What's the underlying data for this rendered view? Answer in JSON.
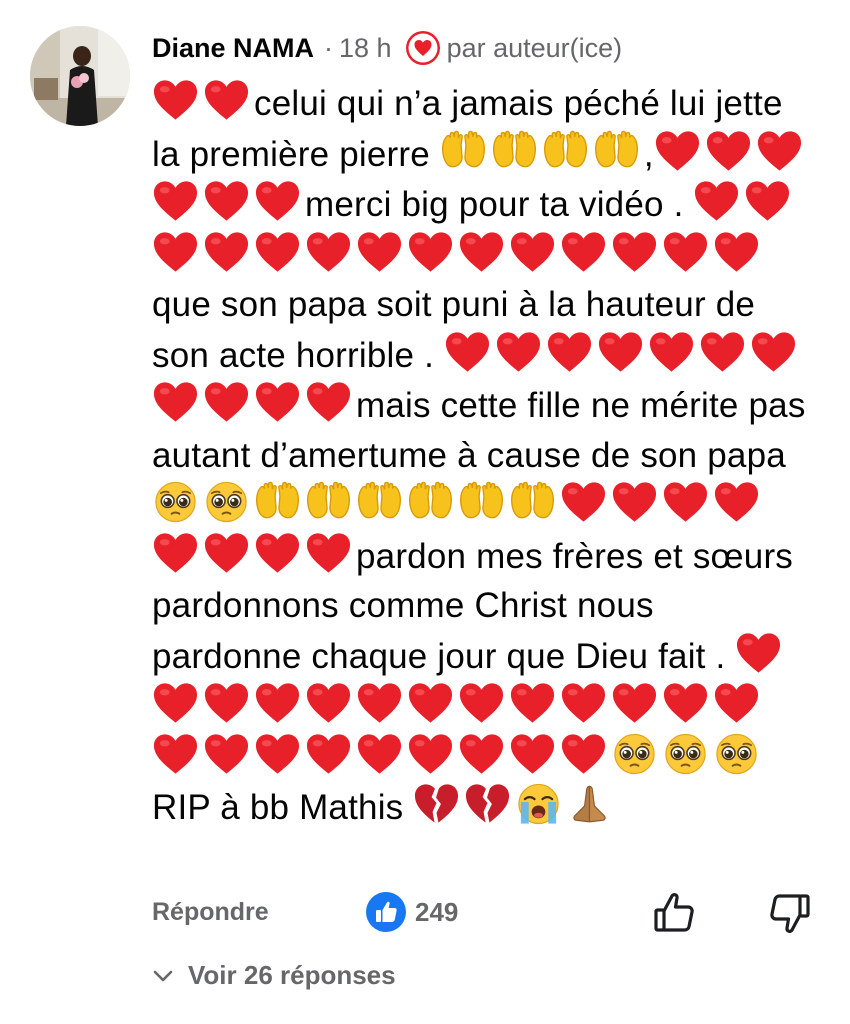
{
  "comment": {
    "author": "Diane NAMA",
    "separator": "·",
    "time": "18 h",
    "byline_icon": "heart-badge-icon",
    "byline": "par auteur(ice)",
    "segments": [
      {
        "e": "red-heart",
        "n": 2
      },
      {
        "t": "celui qui n’a jamais péché lui jette la première pierre "
      },
      {
        "e": "open-hands",
        "n": 4
      },
      {
        "t": ","
      },
      {
        "e": "red-heart",
        "n": 6
      },
      {
        "t": "merci big pour ta vidéo . "
      },
      {
        "e": "red-heart",
        "n": 14
      },
      {
        "t": "que son papa soit puni à la hauteur de son acte horrible . "
      },
      {
        "e": "red-heart",
        "n": 11
      },
      {
        "t": "mais cette fille ne mérite pas autant d’amertume à cause de son papa"
      },
      {
        "e": "pleading-face",
        "n": 2
      },
      {
        "e": "open-hands",
        "n": 6
      },
      {
        "e": "red-heart",
        "n": 8
      },
      {
        "t": "pardon mes frères et sœurs pardonnons comme Christ nous pardonne chaque jour que Dieu fait . "
      },
      {
        "e": "red-heart",
        "n": 22
      },
      {
        "e": "pleading-face",
        "n": 3
      },
      {
        "t": "RIP à bb Mathis "
      },
      {
        "e": "broken-heart",
        "n": 2
      },
      {
        "e": "crying-face",
        "n": 1
      },
      {
        "e": "folded-hands",
        "n": 1
      }
    ]
  },
  "actions": {
    "reply_label": "Répondre",
    "like_icon": "like-badge-icon",
    "like_count": "249",
    "thumb_up_icon": "thumbs-up-icon",
    "thumb_down_icon": "thumbs-down-icon"
  },
  "replies": {
    "icon": "chevron-down-icon",
    "label": "Voir 26 réponses"
  },
  "colors": {
    "author": "#050505",
    "meta": "#65676b",
    "heart_red": "#e8202a",
    "like_blue": "#1877f2",
    "hands_yellow": "#f7c21c"
  }
}
